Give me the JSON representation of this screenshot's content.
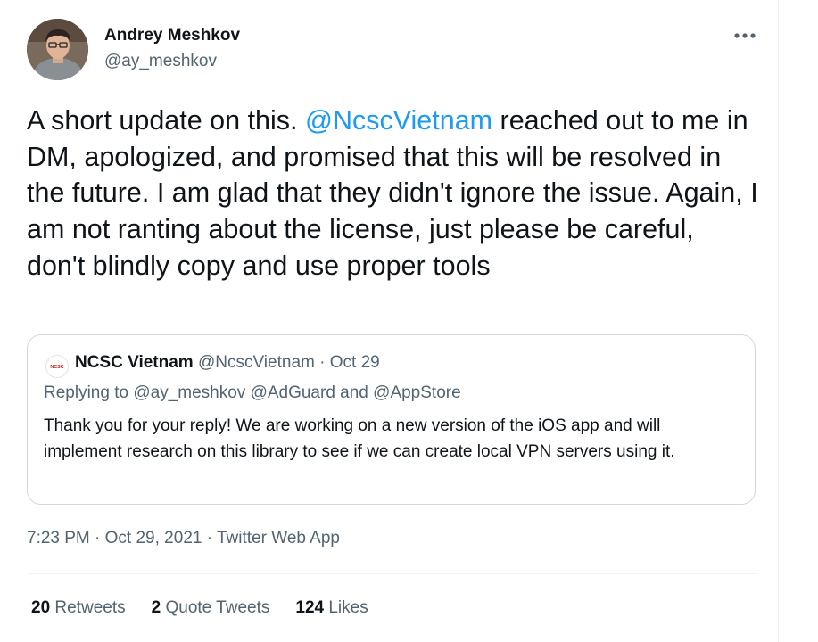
{
  "colors": {
    "link": "#1d9bf0",
    "secondary_text": "#536471",
    "primary_text": "#0f1419",
    "border": "#cfd9de"
  },
  "tweet": {
    "author": {
      "name": "Andrey Meshkov",
      "handle": "@ay_meshkov",
      "avatar_icon": "user-avatar"
    },
    "more_icon": "more-horizontal-icon",
    "text": {
      "part1": "A short update on this. ",
      "mention": "@NcscVietnam",
      "part2": " reached out to me in DM, apologized, and promised that this will be resolved in the future. I am glad that they didn't ignore the issue. Again, I am not ranting about the license, just please be careful, don't blindly copy and use proper tools"
    },
    "quote": {
      "logo": "NCSC",
      "name": "NCSC Vietnam",
      "handle": "@NcscVietnam",
      "separator": " · ",
      "date": "Oct 29",
      "replying_to": "Replying to @ay_meshkov @AdGuard and @AppStore",
      "text": "Thank you for your reply! We are working on a new version of the iOS app and will implement research on this library to see if we can create local VPN servers using it."
    },
    "timestamp": {
      "time": "7:23 PM",
      "separator": " · ",
      "date": "Oct 29, 2021",
      "source": "Twitter Web App"
    },
    "stats": {
      "retweets_count": "20",
      "retweets_label": "Retweets",
      "quotes_count": "2",
      "quotes_label": "Quote Tweets",
      "likes_count": "124",
      "likes_label": "Likes"
    }
  }
}
